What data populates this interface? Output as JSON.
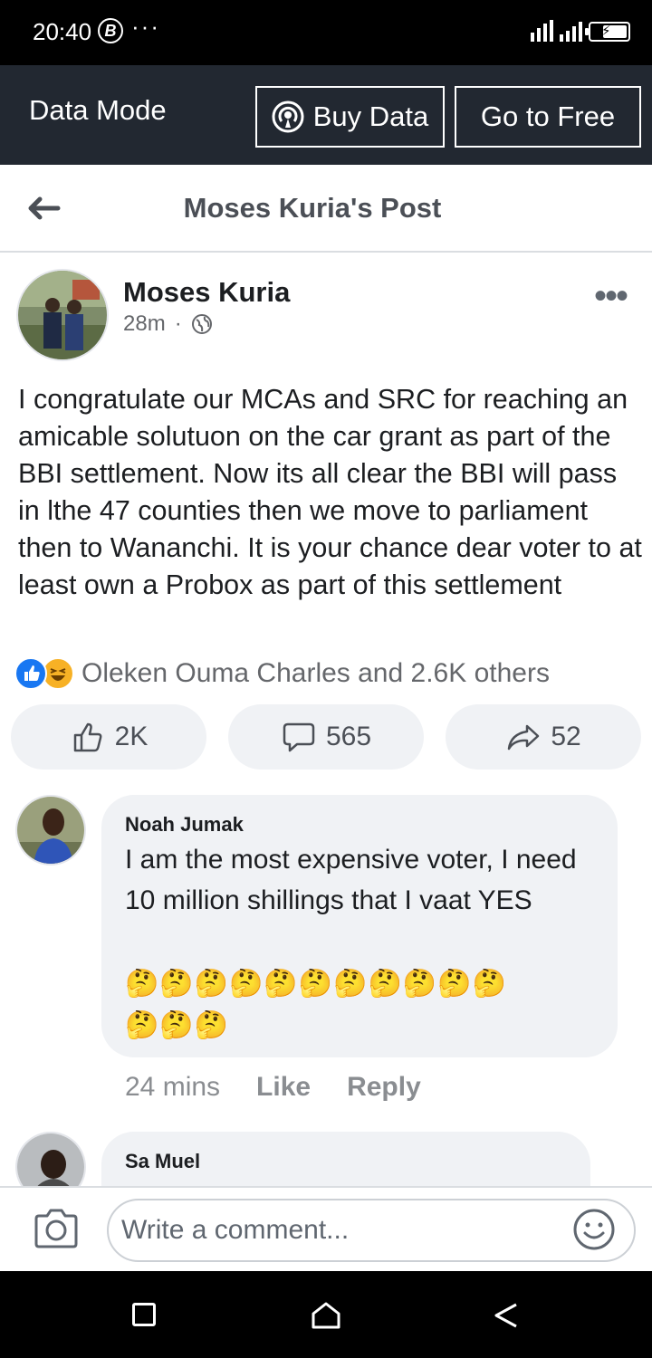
{
  "status_bar": {
    "time": "20:40",
    "b_badge": "B",
    "dots": "···"
  },
  "data_bar": {
    "label": "Data Mode",
    "buy_data": "Buy Data",
    "go_free": "Go to Free"
  },
  "header": {
    "title": "Moses Kuria's Post"
  },
  "post": {
    "author": "Moses Kuria",
    "time": "28m",
    "dot": "·",
    "text": "I congratulate our MCAs and SRC for reaching an amicable solutuon on the car grant as part of the BBI settlement. Now its all clear the BBI will pass in lthe 47 counties then we move to parliament then to Wananchi. It is your chance dear voter to at least own a Probox as part of this settlement",
    "reactions_text": "Oleken Ouma Charles and 2.6K others",
    "likes": "2K",
    "comments": "565",
    "shares": "52"
  },
  "comments": [
    {
      "name": "Noah Jumak",
      "text": "I am the most expensive voter, I need 10 million shillings that I vaat YES",
      "emoji_line1": "🤔🤔🤔🤔🤔🤔🤔🤔🤔🤔🤔",
      "emoji_line2": "🤔🤔🤔",
      "time": "24 mins",
      "like": "Like",
      "reply": "Reply"
    },
    {
      "name": "Sa Muel"
    }
  ],
  "composer": {
    "placeholder": "Write a comment..."
  },
  "colors": {
    "brand": "#1877f2",
    "data_bar": "#222831",
    "bubble": "#f0f2f5",
    "haha": "#f7b125"
  }
}
